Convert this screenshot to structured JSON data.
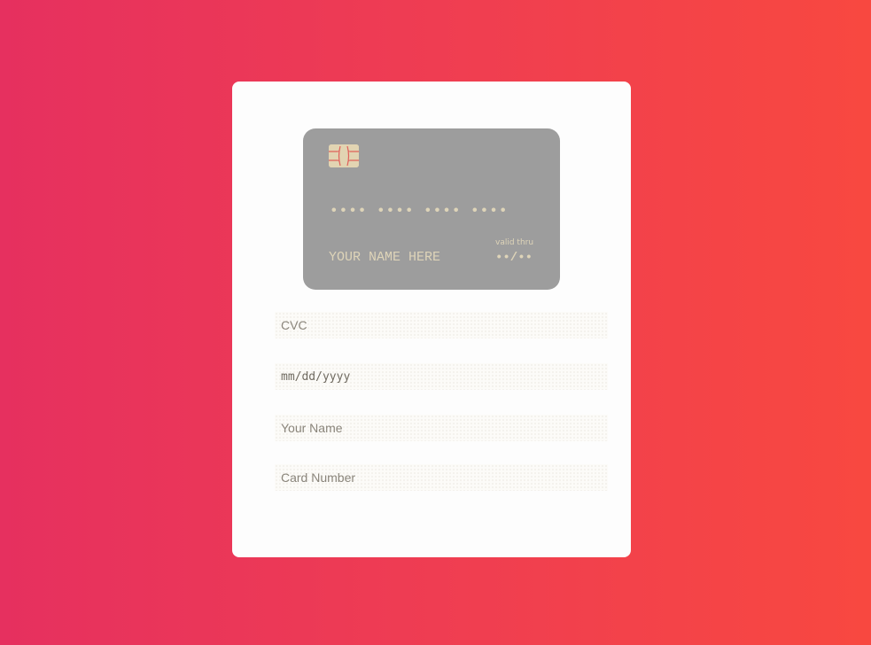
{
  "card_preview": {
    "number_mask": "•••• •••• •••• ••••",
    "name_placeholder": "YOUR NAME HERE",
    "valid_thru_label": "valid thru",
    "expiry_mask": "••/••"
  },
  "form": {
    "cvc_placeholder": "CVC",
    "date_value": "mm/dd/yyyy",
    "name_placeholder": "Your Name",
    "card_number_placeholder": "Card Number"
  },
  "colors": {
    "background_start": "#e6305f",
    "background_end": "#f84840",
    "card": "#9d9d9d",
    "card_text": "#ded4b8",
    "chip": "#e2d4b2",
    "chip_lines": "#e0605a"
  },
  "icons": {
    "chip": "card-chip-icon"
  }
}
